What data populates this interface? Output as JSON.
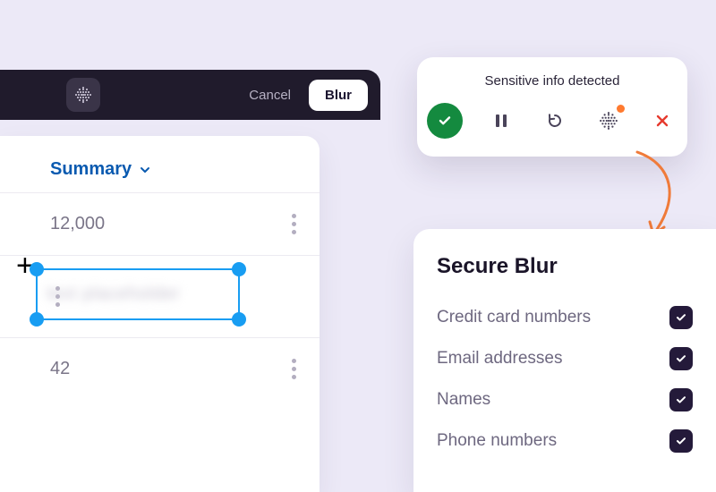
{
  "editor": {
    "cancel_label": "Cancel",
    "blur_label": "Blur",
    "summary_label": "Summary",
    "rows": [
      "12,000",
      "text placeholder",
      "42"
    ]
  },
  "toolbar": {
    "title": "Sensitive info detected"
  },
  "secure": {
    "title": "Secure Blur",
    "options": [
      {
        "label": "Credit card numbers",
        "checked": true
      },
      {
        "label": "Email addresses",
        "checked": true
      },
      {
        "label": "Names",
        "checked": true
      },
      {
        "label": "Phone numbers",
        "checked": true
      }
    ]
  },
  "colors": {
    "accent_blue": "#189df2",
    "brand_green": "#148a3f",
    "alert_orange": "#ff7a2f"
  }
}
